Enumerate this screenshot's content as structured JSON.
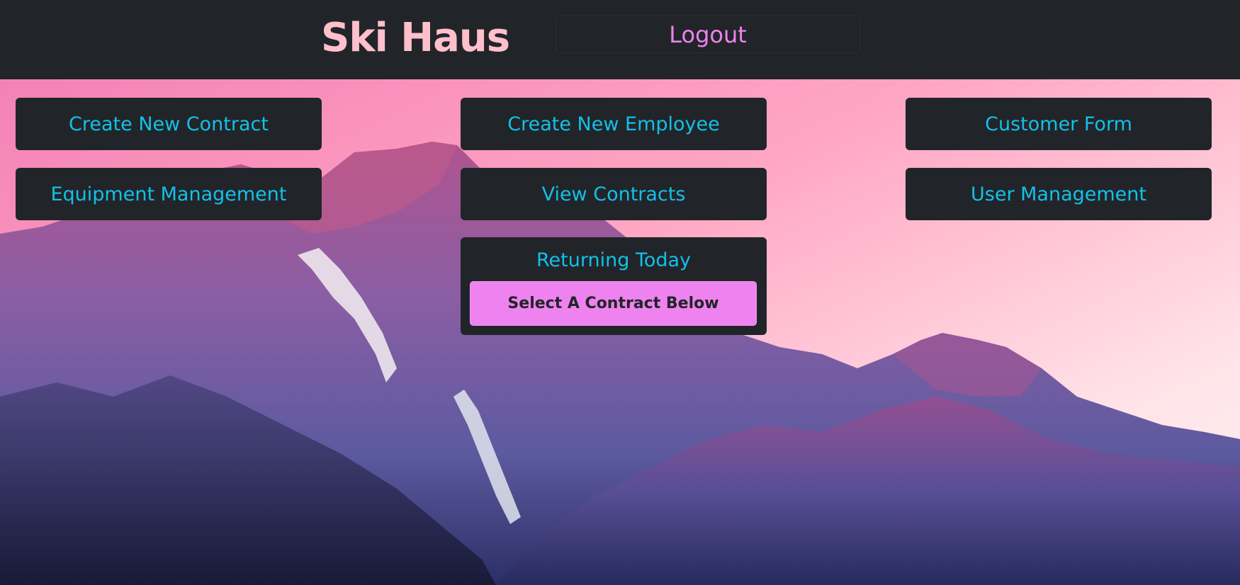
{
  "header": {
    "brand": "Ski Haus",
    "logout_label": "Logout"
  },
  "nav": {
    "create_new_contract": "Create New Contract",
    "create_new_employee": "Create New Employee",
    "customer_form": "Customer Form",
    "equipment_management": "Equipment Management",
    "view_contracts": "View Contracts",
    "user_management": "User Management"
  },
  "returning": {
    "title": "Returning Today",
    "select_label": "Select A Contract Below"
  },
  "colors": {
    "header_bg": "#212529",
    "brand": "#ffc0cb",
    "link": "#13c0e8",
    "accent": "#ee82ee"
  }
}
